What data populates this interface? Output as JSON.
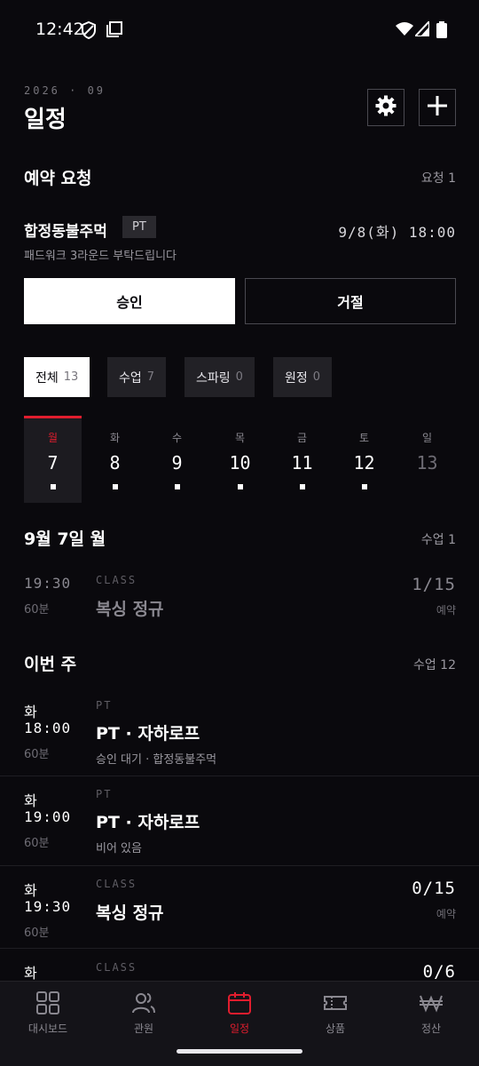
{
  "status_bar": {
    "time": "12:42"
  },
  "header": {
    "date_sub": "2026 · 09",
    "title": "일정"
  },
  "requests": {
    "title": "예약 요청",
    "count": "요청 1",
    "item": {
      "name": "합정동불주먹",
      "badge": "PT",
      "datetime": "9/8(화) 18:00",
      "message": "패드워크 3라운드 부탁드립니다",
      "approve": "승인",
      "reject": "거절"
    }
  },
  "filters": [
    {
      "label": "전체",
      "count": "13"
    },
    {
      "label": "수업",
      "count": "7"
    },
    {
      "label": "스파링",
      "count": "0"
    },
    {
      "label": "원정",
      "count": "0"
    }
  ],
  "week": [
    {
      "name": "월",
      "date": "7"
    },
    {
      "name": "화",
      "date": "8"
    },
    {
      "name": "수",
      "date": "9"
    },
    {
      "name": "목",
      "date": "10"
    },
    {
      "name": "금",
      "date": "11"
    },
    {
      "name": "토",
      "date": "12"
    },
    {
      "name": "일",
      "date": "13"
    }
  ],
  "today": {
    "title": "9월 7일 월",
    "count": "수업 1",
    "sessions": [
      {
        "time": "19:30",
        "duration": "60분",
        "type": "CLASS",
        "title": "복싱 정규",
        "capacity": "1/15",
        "capacity_label": "예약"
      }
    ]
  },
  "this_week": {
    "title": "이번 주",
    "count": "수업 12",
    "sessions": [
      {
        "day": "화",
        "time": "18:00",
        "duration": "60분",
        "type": "PT",
        "title": "PT · 자하로프",
        "subtitle": "승인 대기 · 합정동불주먹"
      },
      {
        "day": "화",
        "time": "19:00",
        "duration": "60분",
        "type": "PT",
        "title": "PT · 자하로프",
        "subtitle": "비어 있음"
      },
      {
        "day": "화",
        "time": "19:30",
        "duration": "60분",
        "type": "CLASS",
        "title": "복싱 정규",
        "capacity": "0/15",
        "capacity_label": "예약"
      },
      {
        "day": "화",
        "type": "CLASS",
        "capacity": "0/6"
      }
    ]
  },
  "nav": [
    {
      "label": "대시보드",
      "icon": "grid-icon"
    },
    {
      "label": "관원",
      "icon": "users-icon"
    },
    {
      "label": "일정",
      "icon": "calendar-icon"
    },
    {
      "label": "상품",
      "icon": "ticket-icon"
    },
    {
      "label": "정산",
      "icon": "won-icon"
    }
  ],
  "colors": {
    "background": "#0a090d",
    "accent": "#e11d2e",
    "surface": "#222126"
  }
}
